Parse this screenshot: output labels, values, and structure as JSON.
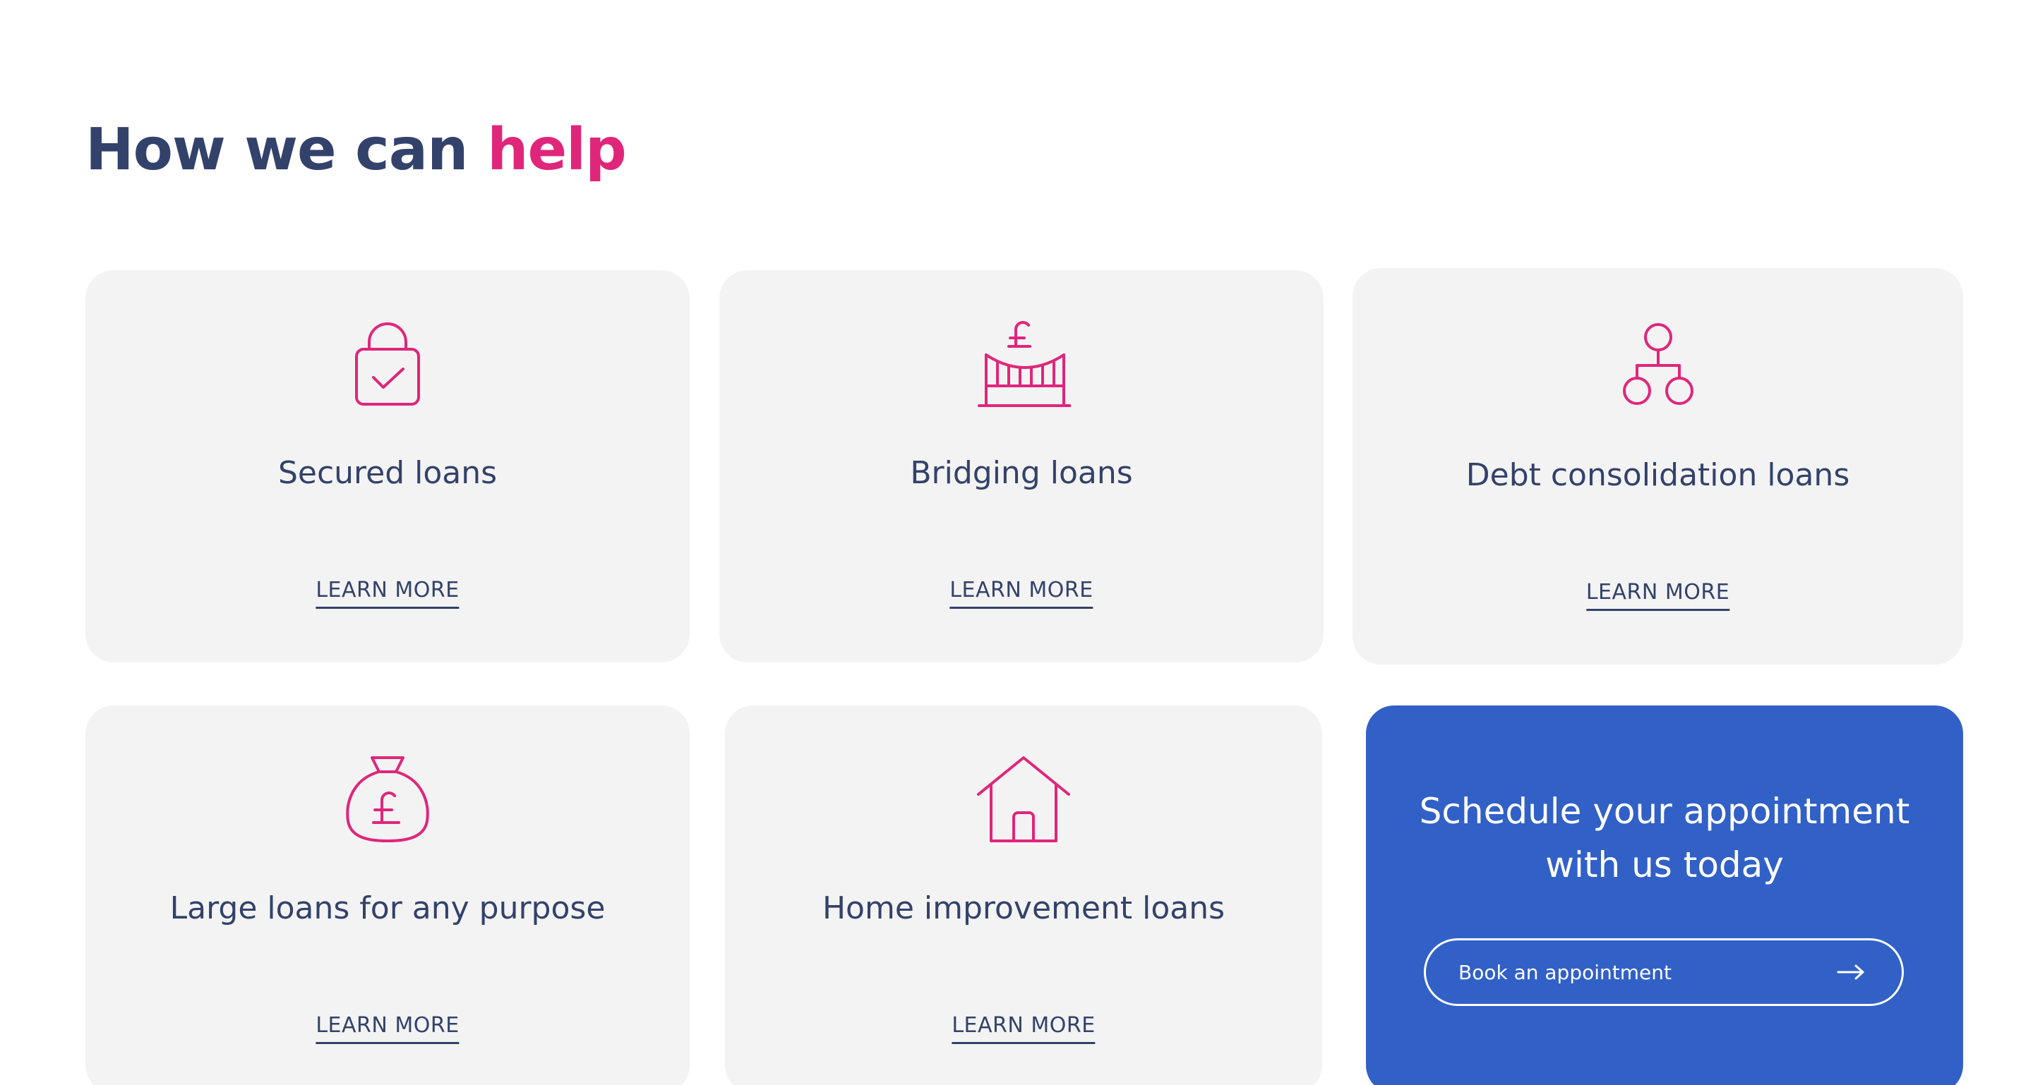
{
  "heading": {
    "prefix": "How we can",
    "accent": "help"
  },
  "cards": [
    {
      "title": "Secured loans",
      "link": "LEARN MORE",
      "icon": "padlock-check-icon"
    },
    {
      "title": "Bridging loans",
      "link": "LEARN MORE",
      "icon": "bridge-pound-icon"
    },
    {
      "title": "Debt consolidation loans",
      "link": "LEARN MORE",
      "icon": "consolidation-nodes-icon"
    },
    {
      "title": "Large loans for any purpose",
      "link": "LEARN MORE",
      "icon": "money-bag-pound-icon"
    },
    {
      "title": "Home improvement loans",
      "link": "LEARN MORE",
      "icon": "house-icon"
    }
  ],
  "cta": {
    "title_line1": "Schedule your appointment",
    "title_line2": "with us today",
    "button_label": "Book an appointment",
    "button_icon": "arrow-right-icon"
  },
  "colors": {
    "navy": "#33426a",
    "accent_pink": "#e0267b",
    "card_bg": "#f3f3f3",
    "cta_blue": "#3160c7"
  }
}
